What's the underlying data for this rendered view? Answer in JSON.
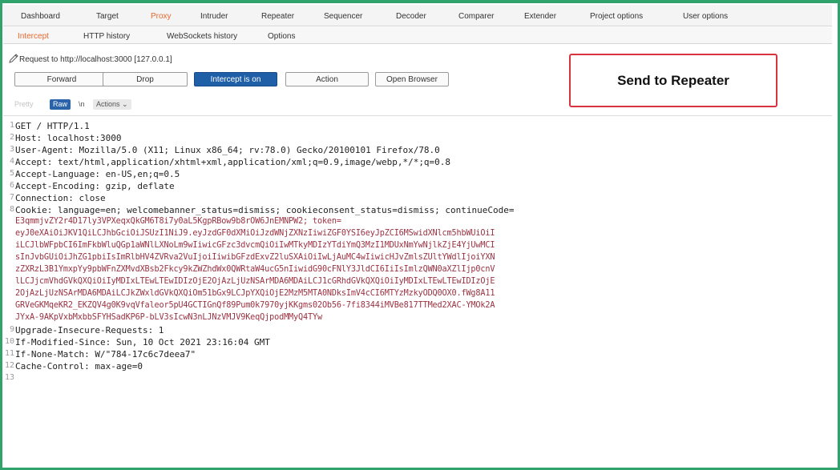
{
  "top_tabs": [
    "Dashboard",
    "Target",
    "Proxy",
    "Intruder",
    "Repeater",
    "Sequencer",
    "Decoder",
    "Comparer",
    "Extender",
    "Project options",
    "User options"
  ],
  "sub_tabs": [
    "Intercept",
    "HTTP history",
    "WebSockets history",
    "Options"
  ],
  "request_info": "Request to http://localhost:3000 [127.0.0.1]",
  "buttons": {
    "forward": "Forward",
    "drop": "Drop",
    "intercept": "Intercept is on",
    "action": "Action",
    "open_browser": "Open Browser"
  },
  "callout": "Send to Repeater",
  "view_tabs": {
    "pretty": "Pretty",
    "raw": "Raw",
    "in": "\\n",
    "actions": "Actions"
  },
  "request_lines": [
    {
      "n": "1",
      "text": "GET / HTTP/1.1"
    },
    {
      "n": "2",
      "text": "Host: localhost:3000"
    },
    {
      "n": "3",
      "text": "User-Agent: Mozilla/5.0 (X11; Linux x86_64; rv:78.0) Gecko/20100101 Firefox/78.0"
    },
    {
      "n": "4",
      "text": "Accept: text/html,application/xhtml+xml,application/xml;q=0.9,image/webp,*/*;q=0.8"
    },
    {
      "n": "5",
      "text": "Accept-Language: en-US,en;q=0.5"
    },
    {
      "n": "6",
      "text": "Accept-Encoding: gzip, deflate"
    },
    {
      "n": "7",
      "text": "Connection: close"
    },
    {
      "n": "8",
      "text": "Cookie: language=en; welcomebanner_status=dismiss; cookieconsent_status=dismiss; continueCode="
    },
    {
      "n": "9",
      "text": "Upgrade-Insecure-Requests: 1"
    },
    {
      "n": "10",
      "text": "If-Modified-Since: Sun, 10 Oct 2021 23:16:04 GMT"
    },
    {
      "n": "11",
      "text": "If-None-Match: W/\"784-17c6c7deea7\""
    },
    {
      "n": "12",
      "text": "Cache-Control: max-age=0"
    },
    {
      "n": "13",
      "text": ""
    }
  ],
  "cookie_continuation": [
    "E3qmmjvZY2r4D17ly3VPXeqxQkGM6T8i7y0aL5KgpRBow9b8rOW6JnEMNPW2; token=",
    "eyJ0eXAiOiJKV1QiLCJhbGciOiJSUzI1NiJ9.eyJzdGF0dXMiOiJzdWNjZXNzIiwiZGF0YSI6eyJpZCI6MSwidXNlcm5hbWUiOiI",
    "iLCJlbWFpbCI6ImFkbWluQGp1aWNlLXNoLm9wIiwicGFzc3dvcmQiOiIwMTkyMDIzYTdiYmQ3MzI1MDUxNmYwNjlkZjE4YjUwMCI",
    "sInJvbGUiOiJhZG1pbiIsImRlbHV4ZVRva2VuIjoiIiwibGFzdExvZ2luSXAiOiIwLjAuMC4wIiwicHJvZmlsZUltYWdlIjoiYXN",
    "zZXRzL3B1YmxpYy9pbWFnZXMvdXBsb2Fkcy9kZWZhdWx0QWRtaW4ucG5nIiwidG90cFNlY3JldCI6IiIsImlzQWN0aXZlIjp0cnV",
    "lLCJjcmVhdGVkQXQiOiIyMDIxLTEwLTEwIDIzOjE2OjAzLjUzNSArMDA6MDAiLCJ1cGRhdGVkQXQiOiIyMDIxLTEwLTEwIDIzOjE",
    "2OjAzLjUzNSArMDA6MDAiLCJkZWxldGVkQXQiOm51bGx9LCJpYXQiOjE2MzM5MTA0NDksImV4cCI6MTYzMzkyODQ0OX0.fWg8A11",
    "GRVeGKMqeKR2_EKZQV4g0K9vqVfaleor5pU4GCTIGnQf89Pum0k7970yjKKgms02Ob56-7fi8344iMVBe817TTMed2XAC-YMOk2A",
    "JYxA-9AKpVxbMxbbSFYHSadKP6P-bLV3sIcwN3nLJNzVMJV9KeqQjpodMMyQ4TYw"
  ],
  "colors": {
    "frame": "#2fa36b",
    "active_tab": "#e8692f",
    "intercept_button": "#1f5fa8",
    "callout_border": "#d8333f",
    "header_value": "#9a3242"
  }
}
